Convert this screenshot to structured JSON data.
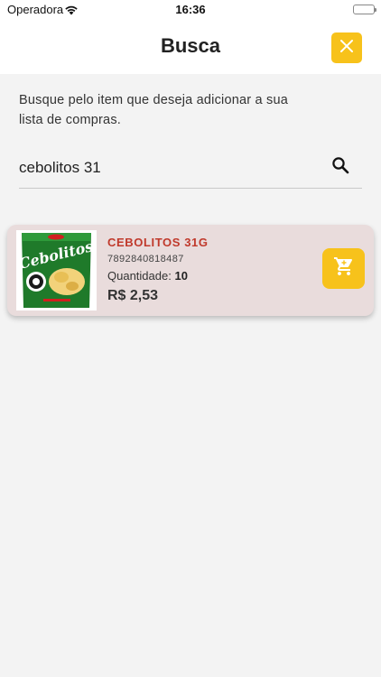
{
  "status_bar": {
    "carrier": "Operadora",
    "time": "16:36"
  },
  "header": {
    "title": "Busca"
  },
  "instruction": "Busque pelo item que deseja adicionar a sua lista de compras.",
  "search": {
    "value": "cebolitos 31"
  },
  "results": [
    {
      "name": "CEBOLITOS 31G",
      "barcode": "7892840818487",
      "quantity_label": "Quantidade:",
      "quantity": "10",
      "price": "R$ 2,53",
      "image_brand": "Cebolitos"
    }
  ],
  "icons": {
    "close": "close-icon",
    "search": "search-icon",
    "cart": "cart-icon",
    "wifi": "wifi-icon",
    "battery": "battery-icon"
  },
  "colors": {
    "accent": "#f7c21b",
    "product_name": "#c0392b",
    "card_background": "#e9dcdc",
    "page_background": "#f3f3f3"
  }
}
